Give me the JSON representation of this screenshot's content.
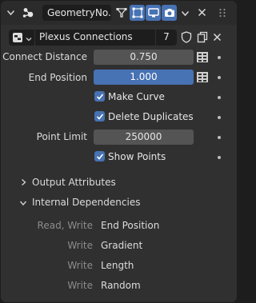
{
  "header": {
    "node_group_name": "GeometryNo...",
    "icons": [
      "chevron-down-icon",
      "modifier-icon",
      "funnel-icon",
      "edit-mode-icon",
      "viewport-icon",
      "camera-icon",
      "dropdown-icon",
      "close-icon"
    ]
  },
  "node_row": {
    "name": "Plexus Connections",
    "user_count": "7",
    "icons": [
      "node-tree-icon",
      "shield-icon",
      "duplicate-icon",
      "close-icon"
    ]
  },
  "inputs": [
    {
      "label": "Connect Distance",
      "value": "0.750",
      "highlighted": false
    },
    {
      "label": "End Position",
      "value": "1.000",
      "highlighted": true
    }
  ],
  "checkboxes": [
    {
      "label": "Make Curve",
      "checked": true
    },
    {
      "label": "Delete Duplicates",
      "checked": true
    }
  ],
  "point_limit": {
    "label": "Point Limit",
    "value": "250000"
  },
  "show_points": {
    "label": "Show Points",
    "checked": true
  },
  "sections": {
    "output_attributes": "Output Attributes",
    "internal_dependencies": "Internal Dependencies"
  },
  "dependencies": [
    {
      "access": "Read, Write",
      "name": "End Position"
    },
    {
      "access": "Write",
      "name": "Gradient"
    },
    {
      "access": "Write",
      "name": "Length"
    },
    {
      "access": "Write",
      "name": "Random"
    }
  ],
  "colors": {
    "accent": "#4772b3",
    "panel_bg": "#303030",
    "field_bg": "#545454",
    "dark_field_bg": "#1d1d1d"
  }
}
